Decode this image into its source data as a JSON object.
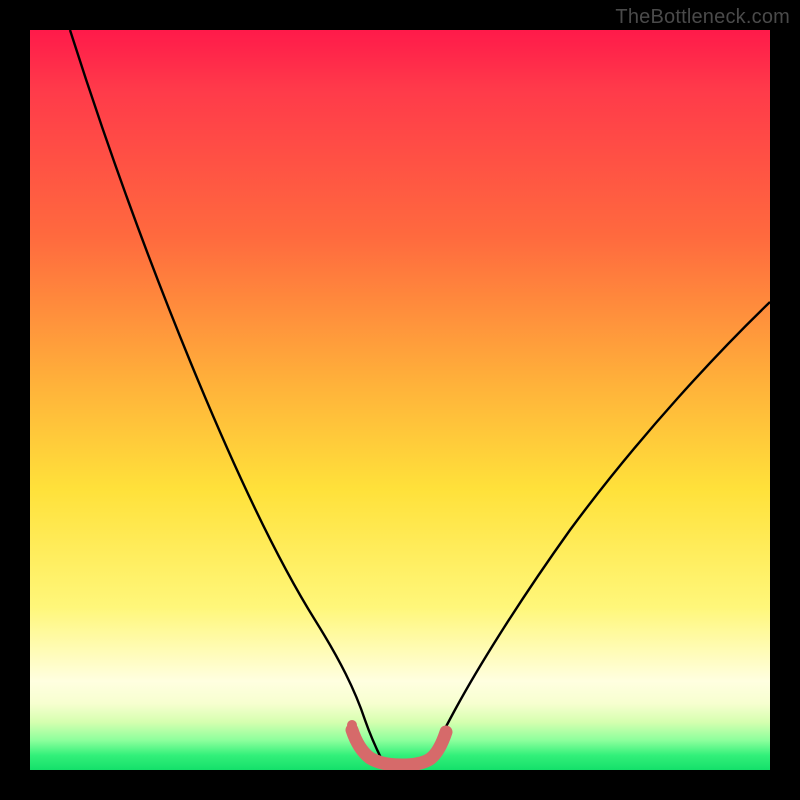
{
  "watermark": "TheBottleneck.com",
  "chart_data": {
    "type": "line",
    "title": "",
    "xlabel": "",
    "ylabel": "",
    "xlim": [
      0,
      100
    ],
    "ylim": [
      0,
      100
    ],
    "grid": false,
    "legend": false,
    "annotations": [],
    "series": [
      {
        "name": "curve-left",
        "x": [
          5,
          10,
          15,
          20,
          25,
          30,
          35,
          38,
          40,
          42,
          44,
          46,
          48
        ],
        "y": [
          100,
          85,
          71,
          58,
          46,
          35,
          24,
          17,
          13,
          9,
          6,
          3,
          1
        ]
      },
      {
        "name": "curve-right",
        "x": [
          52,
          54,
          56,
          58,
          60,
          63,
          67,
          72,
          78,
          85,
          92,
          100
        ],
        "y": [
          1,
          3,
          5,
          8,
          11,
          15,
          21,
          28,
          36,
          45,
          54,
          63
        ]
      },
      {
        "name": "valley-marker",
        "x": [
          44,
          45,
          46,
          47,
          48,
          49,
          50,
          51,
          52,
          53,
          54,
          55
        ],
        "y": [
          4,
          2,
          1,
          0.5,
          0.3,
          0.3,
          0.3,
          0.3,
          0.5,
          1,
          2,
          3
        ]
      }
    ],
    "colors": {
      "curve": "#000000",
      "marker": "#d66a6a",
      "gradient_top": "#ff1a4a",
      "gradient_mid": "#ffe13a",
      "gradient_bottom": "#14e06a"
    }
  }
}
